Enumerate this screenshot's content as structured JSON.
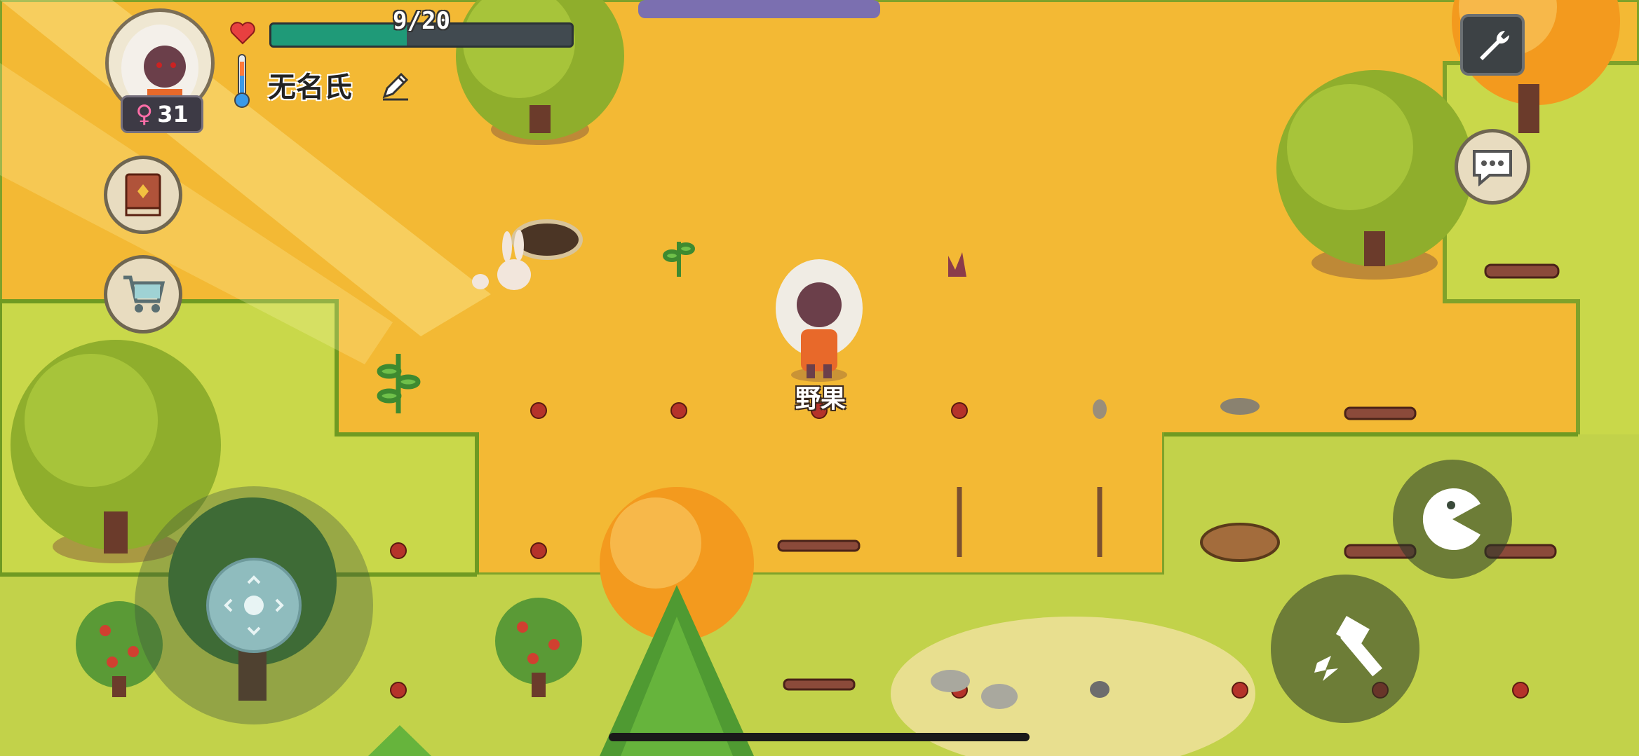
{
  "player": {
    "gender_symbol": "♀",
    "age": "31",
    "name": "无名氏",
    "health_text": "9/20",
    "health_fraction": 0.45
  },
  "world": {
    "nearby_item_label": "野果"
  },
  "icons": {
    "heart": "heart-icon",
    "temperature": "thermometer-icon",
    "edit": "pencil-icon",
    "book": "book-icon",
    "shop": "shopping-cart-icon",
    "settings": "wrench-icon",
    "chat": "chat-bubble-icon",
    "eat": "pacman-eat-icon",
    "tool": "hammer-icon"
  },
  "colors": {
    "health_fill": "#1f9a78",
    "sand": "#f3b934",
    "grass": "#c9d84a",
    "autumn_tree": "#f39a1e"
  }
}
